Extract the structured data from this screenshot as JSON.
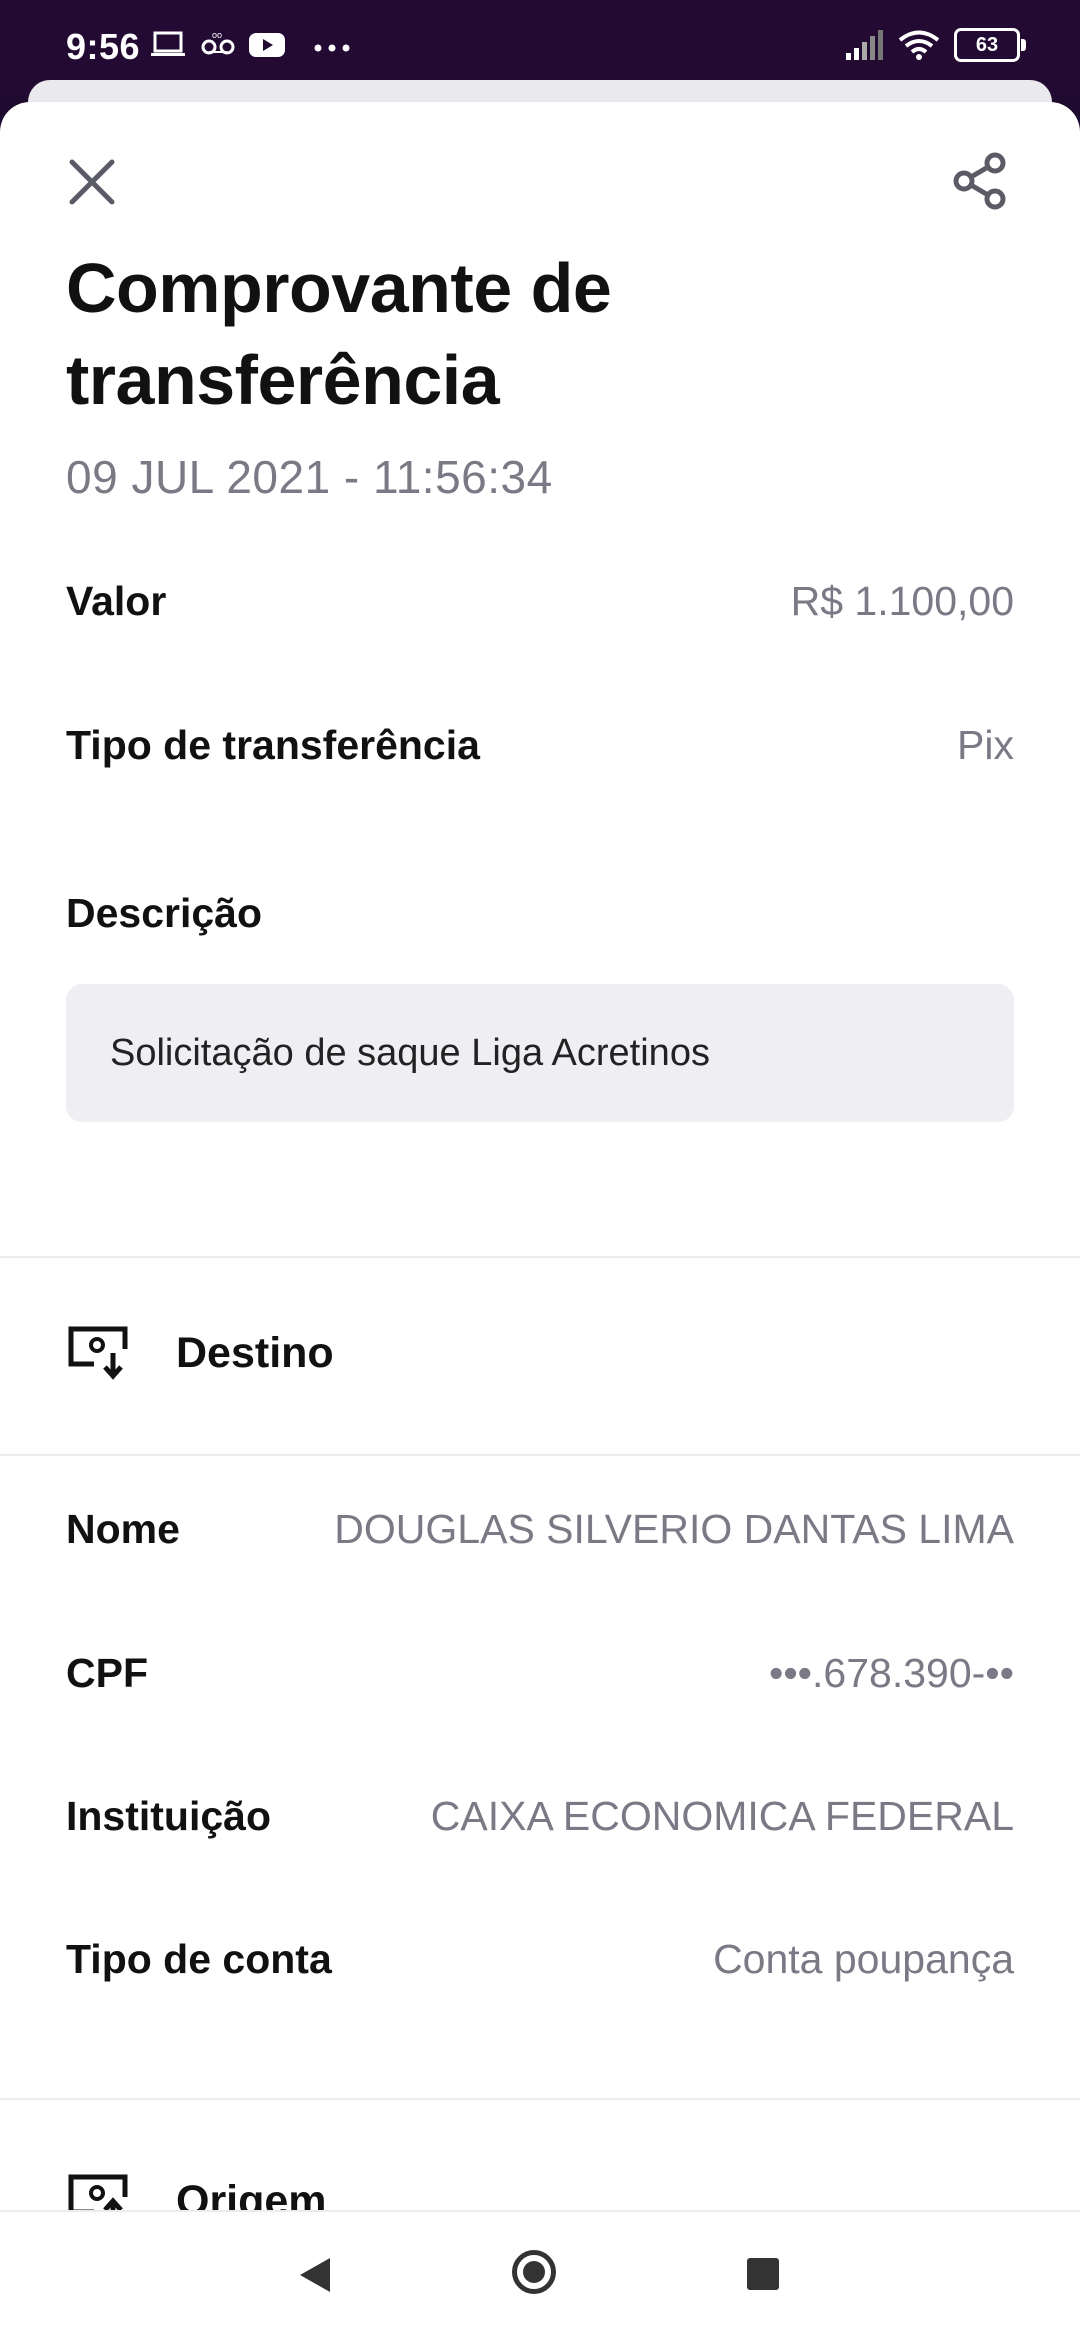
{
  "status_bar": {
    "time": "9:56",
    "icons": [
      "laptop-icon",
      "voicemail-icon",
      "youtube-icon",
      "more-dots-icon"
    ],
    "battery": "63"
  },
  "header": {
    "title": "Comprovante de transferência",
    "datetime": "09 JUL 2021 - 11:56:34"
  },
  "summary": {
    "valor_label": "Valor",
    "valor_value": "R$ 1.100,00",
    "tipo_label": "Tipo de transferência",
    "tipo_value": "Pix",
    "descricao_label": "Descrição",
    "descricao_value": "Solicitação de saque Liga Acretinos"
  },
  "destino": {
    "section_label": "Destino",
    "nome_label": "Nome",
    "nome_value": "DOUGLAS SILVERIO DANTAS LIMA",
    "cpf_label": "CPF",
    "cpf_value": "•••.678.390-••",
    "instituicao_label": "Instituição",
    "instituicao_value": "CAIXA ECONOMICA FEDERAL",
    "tipo_conta_label": "Tipo de conta",
    "tipo_conta_value": "Conta poupança"
  },
  "origem": {
    "section_label": "Origem"
  },
  "colors": {
    "status_bar_bg": "#220a33",
    "muted_text": "#7a7a86",
    "description_bg": "#efeff3"
  }
}
